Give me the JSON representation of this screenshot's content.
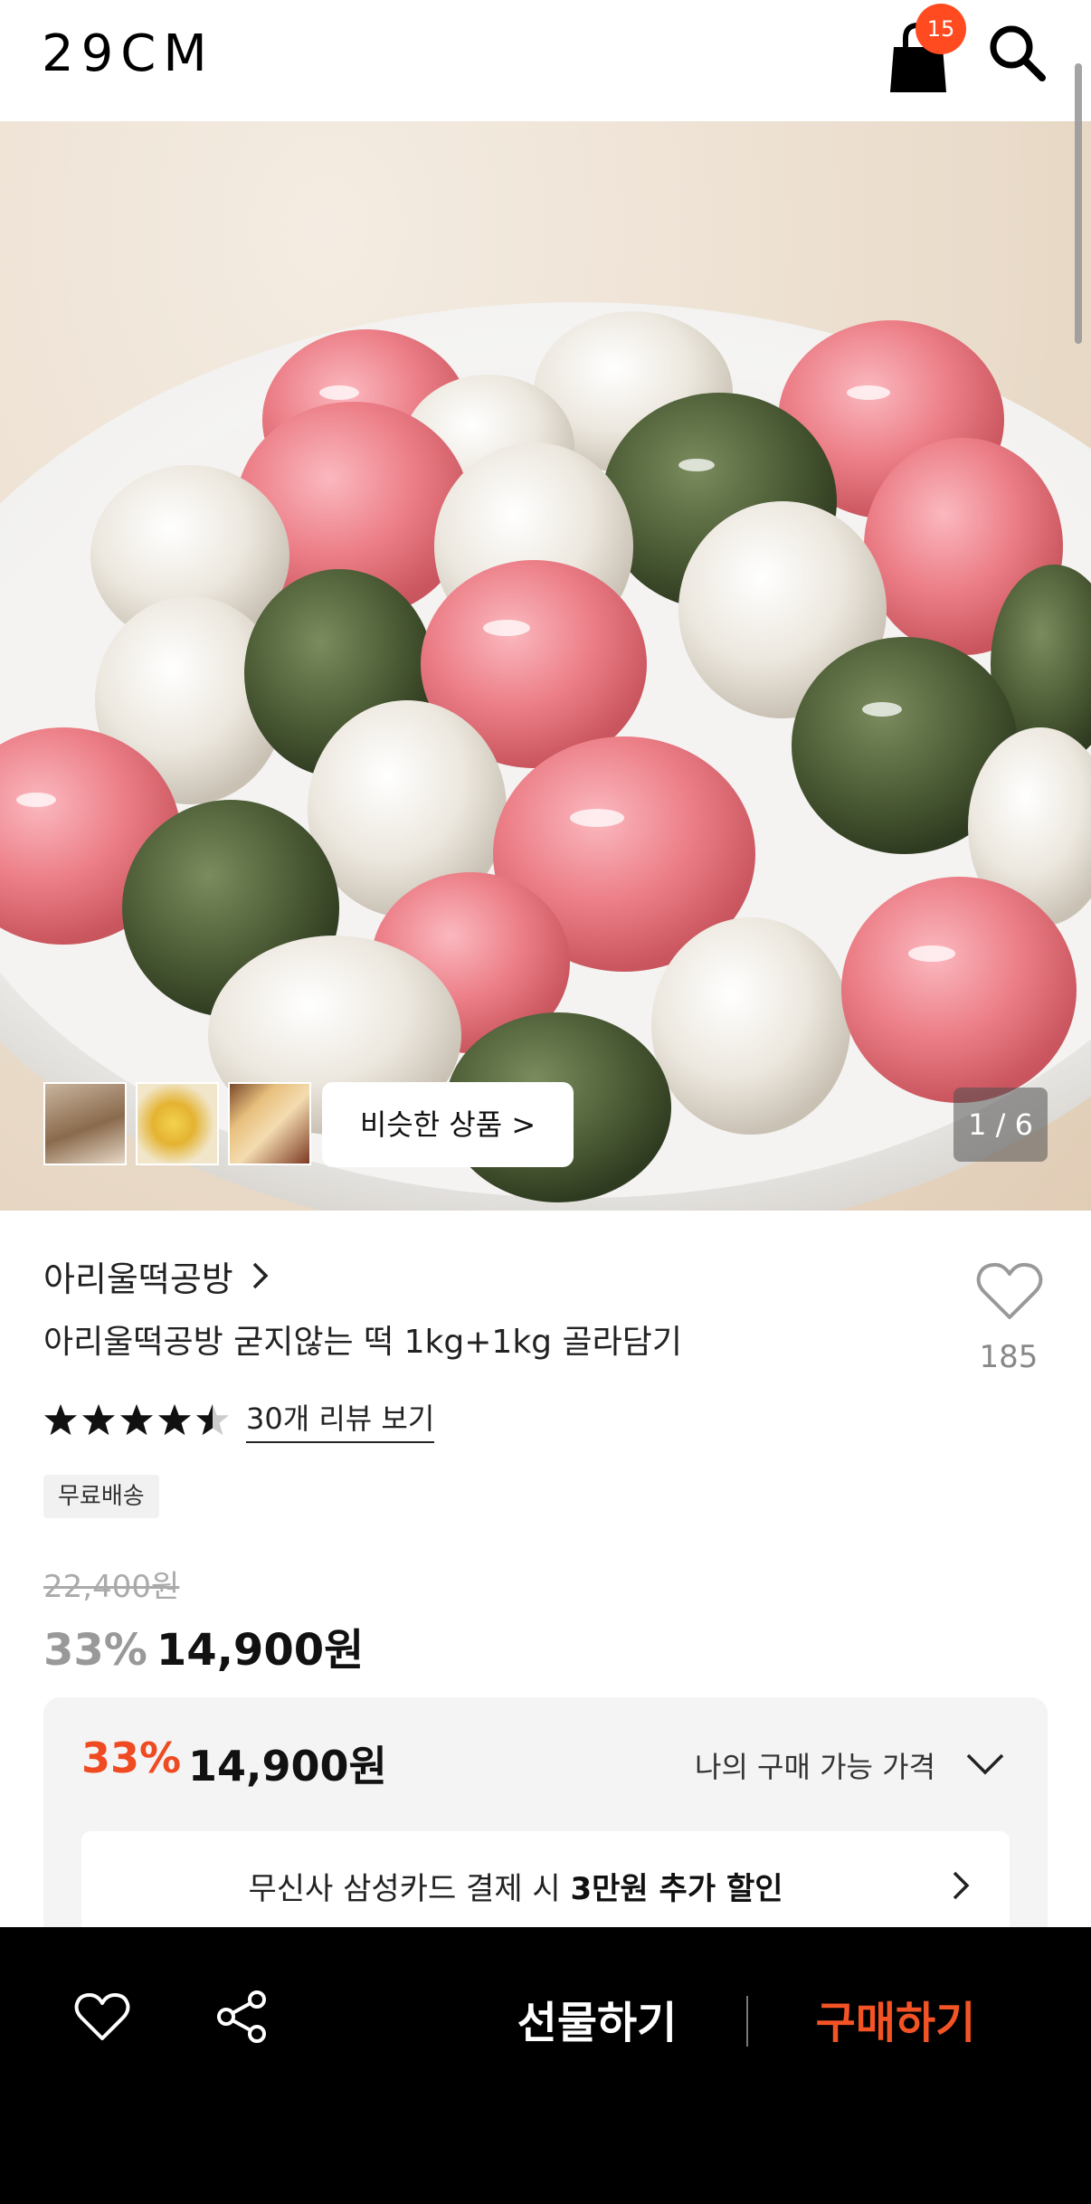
{
  "header": {
    "logo": "29CM",
    "cart_count": "15"
  },
  "hero": {
    "image_counter": "1 / 6",
    "similar_button_label": "비슷한 상품 >"
  },
  "product": {
    "brand": "아리울떡공방",
    "title": "아리울떡공방 굳지않는 떡 1kg+1kg 골라담기",
    "like_count": "185",
    "rating": 4.5,
    "review_link": "30개 리뷰 보기",
    "shipping_badge": "무료배송",
    "original_price": "22,400원",
    "discount": "33%",
    "price": "14,900원"
  },
  "price_box": {
    "discount": "33%",
    "price": "14,900원",
    "label": "나의 구매 가능 가격",
    "promo_prefix": "무신사 삼성카드 결제 시 ",
    "promo_highlight": "3만원 추가 할인"
  },
  "bottom_bar": {
    "gift_label": "선물하기",
    "buy_label": "구매하기"
  },
  "colors": {
    "accent": "#ef4a21",
    "badge": "#ff4b1f",
    "bottom_bar": "#000000"
  }
}
